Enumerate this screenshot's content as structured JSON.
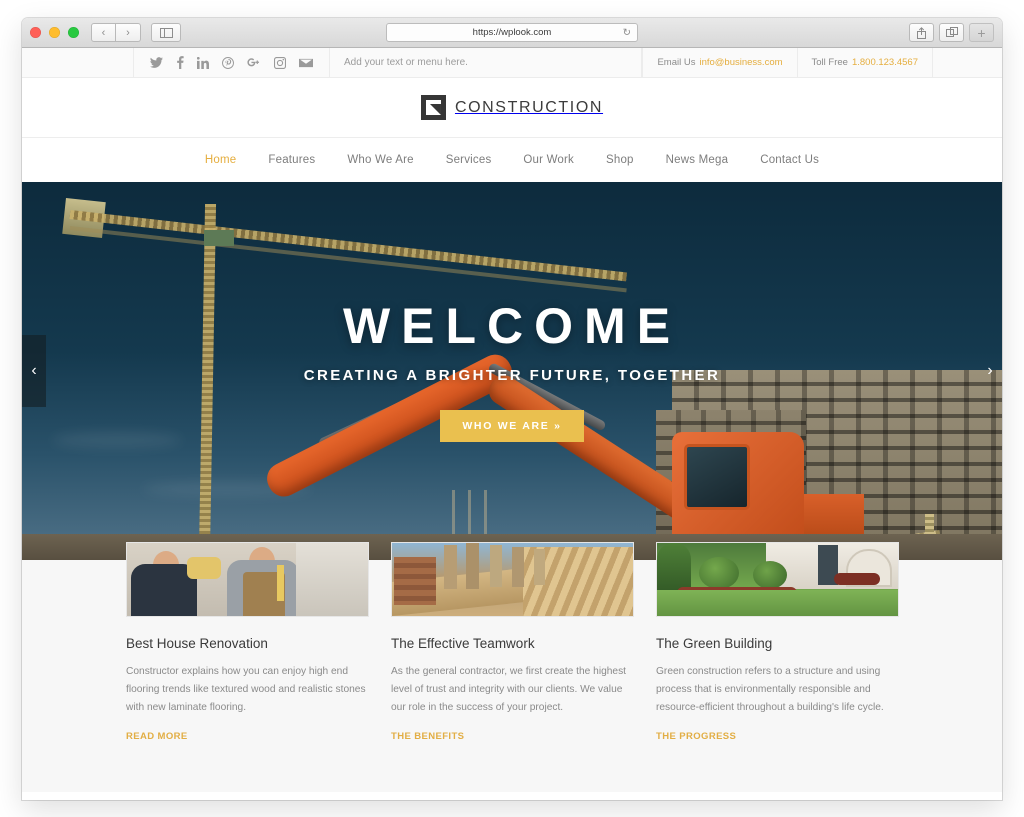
{
  "browser": {
    "url": "https://wplook.com",
    "back_label": "‹",
    "forward_label": "›",
    "reload_label": "↻",
    "sidebar_icon": "sidebar-icon",
    "share_icon": "share-icon",
    "tabs_icon": "tabs-icon",
    "newtab_label": "+"
  },
  "topbar": {
    "social": [
      {
        "name": "twitter-icon",
        "label": "Twitter"
      },
      {
        "name": "facebook-icon",
        "label": "Facebook"
      },
      {
        "name": "linkedin-icon",
        "label": "LinkedIn"
      },
      {
        "name": "pinterest-icon",
        "label": "Pinterest"
      },
      {
        "name": "googleplus-icon",
        "label": "Google Plus"
      },
      {
        "name": "instagram-icon",
        "label": "Instagram"
      },
      {
        "name": "email-icon",
        "label": "Email"
      }
    ],
    "menu_placeholder": "Add your text or menu here.",
    "email_label": "Email Us",
    "email_value": "info@business.com",
    "phone_label": "Toll Free",
    "phone_value": "1.800.123.4567"
  },
  "logo": {
    "text": "CONSTRUCTION",
    "mark": "construction-logo-icon"
  },
  "nav": [
    {
      "label": "Home",
      "active": true
    },
    {
      "label": "Features",
      "active": false
    },
    {
      "label": "Who We Are",
      "active": false
    },
    {
      "label": "Services",
      "active": false
    },
    {
      "label": "Our Work",
      "active": false
    },
    {
      "label": "Shop",
      "active": false
    },
    {
      "label": "News Mega",
      "active": false
    },
    {
      "label": "Contact Us",
      "active": false
    }
  ],
  "hero": {
    "title": "WELCOME",
    "subtitle": "CREATING A BRIGHTER FUTURE, TOGETHER",
    "button": "WHO WE ARE »",
    "prev": "‹",
    "next": "›",
    "colors": {
      "sky": "#14394e",
      "machine": "#d9602a",
      "accent": "#eac04f"
    }
  },
  "cards": [
    {
      "thumb": "two-construction-workers-photo",
      "title": "Best House Renovation",
      "body": "Constructor explains how you can enjoy high end flooring trends like textured wood and realistic stones with new laminate flooring.",
      "link": "READ MORE"
    },
    {
      "thumb": "framing-crew-on-roof-photo",
      "title": "The Effective Teamwork",
      "body": "As the general contractor, we first create the highest level of trust and integrity with our clients. We value our role in the success of your project.",
      "link": "THE BENEFITS"
    },
    {
      "thumb": "green-lawn-landscaping-photo",
      "title": "The Green Building",
      "body": "Green construction refers to a structure and using process that is environmentally responsible and resource-efficient throughout a building's life cycle.",
      "link": "THE PROGRESS"
    }
  ],
  "colors": {
    "accent": "#e5ae3f",
    "gold": "#eac04f",
    "text": "#3a3a3a",
    "muted": "#8a8a8a"
  }
}
